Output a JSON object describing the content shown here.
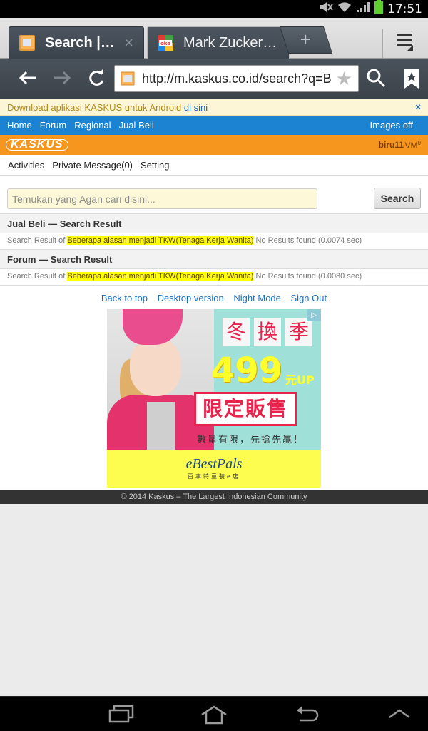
{
  "statusbar": {
    "time": "17:51"
  },
  "tabs": [
    {
      "title": "Search |…",
      "close": "×",
      "active": true
    },
    {
      "title": "Mark Zucker…",
      "active": false
    }
  ],
  "new_tab_label": "+",
  "toolbar": {
    "url": "http://m.kaskus.co.id/search?q=B"
  },
  "banner": {
    "text": "Download aplikasi KASKUS untuk Android",
    "link": "di sini",
    "close": "×"
  },
  "nav": {
    "items": [
      "Home",
      "Forum",
      "Regional",
      "Jual Beli"
    ],
    "images_off": "Images off"
  },
  "logo": "KASKUS",
  "user": {
    "name": "biru11",
    "vm": "VM",
    "vm_count": "0"
  },
  "subnav": [
    "Activities",
    "Private Message(0)",
    "Setting"
  ],
  "search": {
    "placeholder": "Temukan yang Agan cari disini...",
    "button": "Search"
  },
  "results": [
    {
      "heading": "Jual Beli — Search Result",
      "prefix": "Search Result of",
      "query": "Beberapa alasan menjadi TKW(Tenaga Kerja Wanita)",
      "status": "No Results found (0.0074 sec)"
    },
    {
      "heading": "Forum — Search Result",
      "prefix": "Search Result of",
      "query": "Beberapa alasan menjadi TKW(Tenaga Kerja Wanita)",
      "status": "No Results found (0.0080 sec)"
    }
  ],
  "footer_links": [
    "Back to top",
    "Desktop version",
    "Night Mode",
    "Sign Out"
  ],
  "ad": {
    "season": [
      "冬",
      "換",
      "季"
    ],
    "price": "499",
    "price_suffix": "元UP",
    "limited": "限定販售",
    "quantity": "數量有限，先搶先贏！",
    "brand": "eBestPals",
    "brand_sub": "百事特童裝e店"
  },
  "copyright": "© 2014 Kaskus – The Largest Indonesian Community",
  "colors": {
    "nav_blue": "#1b83d1",
    "kaskus_orange": "#f7961f",
    "highlight": "#ffff00",
    "link": "#1a6fc0"
  }
}
